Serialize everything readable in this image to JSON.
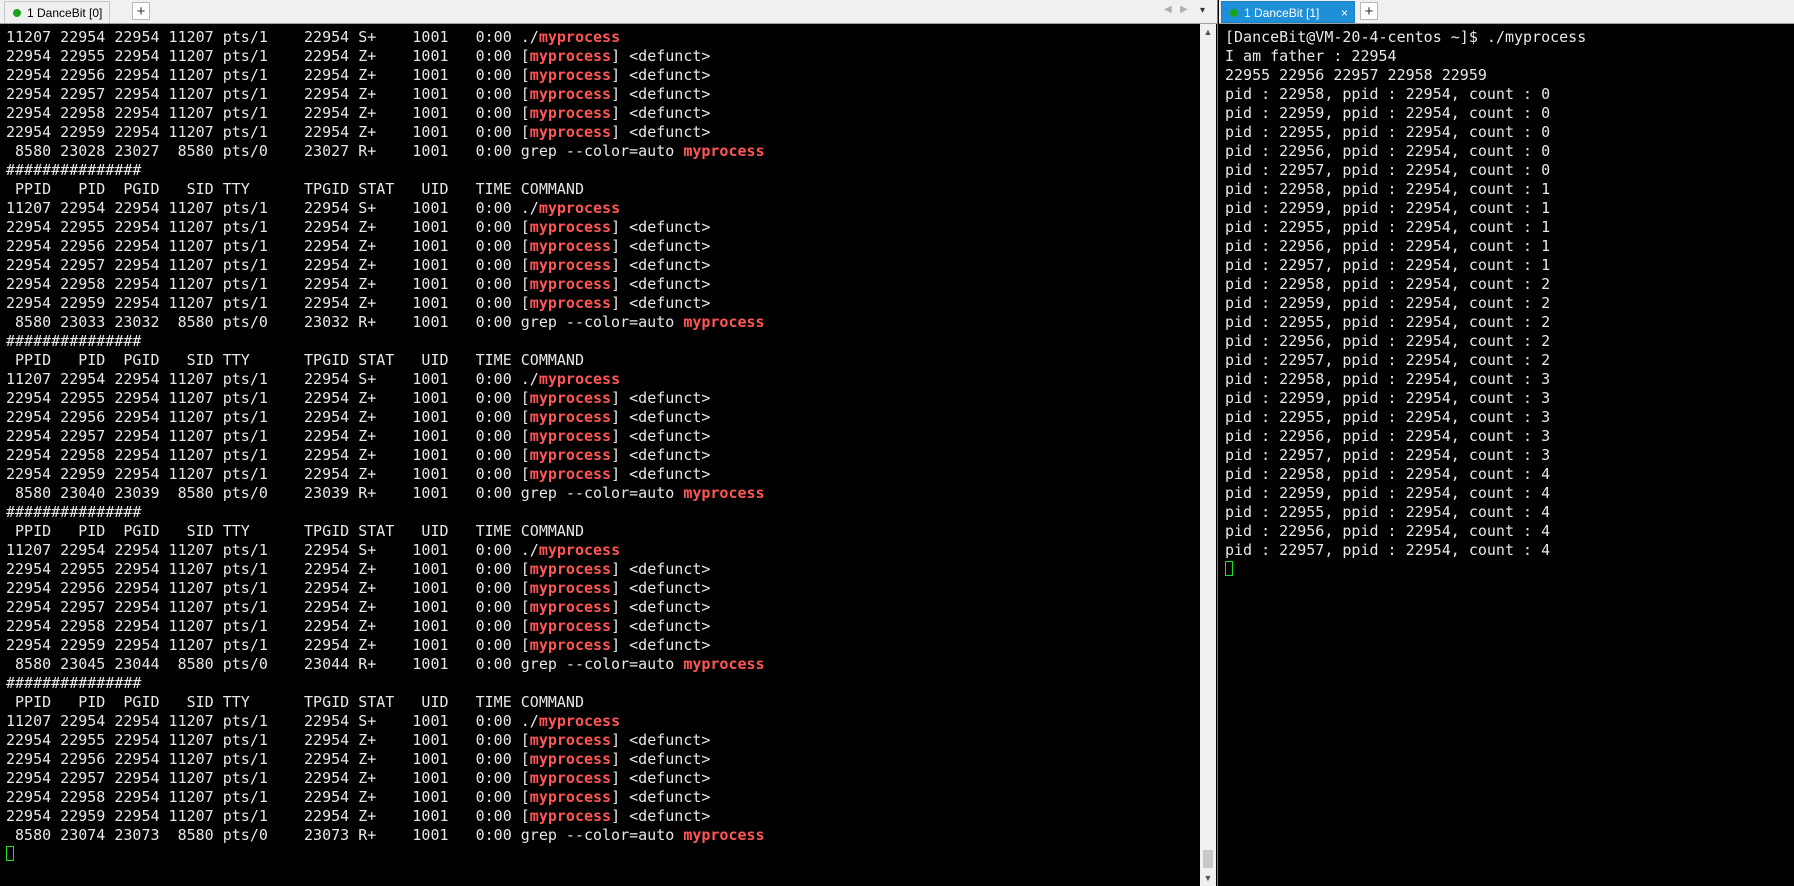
{
  "left": {
    "tab_label": "1 DanceBit [0]",
    "add_tab": "+",
    "nav_prev": "◀",
    "nav_next": "▶",
    "nav_menu": "▾",
    "lines": [
      {
        "pre": "11207 22954 22954 11207 pts/1    22954 S+    1001   0:00 ./",
        "hl": "myprocess",
        "post": ""
      },
      {
        "pre": "22954 22955 22954 11207 pts/1    22954 Z+    1001   0:00 [",
        "hl": "myprocess",
        "post": "] <defunct>"
      },
      {
        "pre": "22954 22956 22954 11207 pts/1    22954 Z+    1001   0:00 [",
        "hl": "myprocess",
        "post": "] <defunct>"
      },
      {
        "pre": "22954 22957 22954 11207 pts/1    22954 Z+    1001   0:00 [",
        "hl": "myprocess",
        "post": "] <defunct>"
      },
      {
        "pre": "22954 22958 22954 11207 pts/1    22954 Z+    1001   0:00 [",
        "hl": "myprocess",
        "post": "] <defunct>"
      },
      {
        "pre": "22954 22959 22954 11207 pts/1    22954 Z+    1001   0:00 [",
        "hl": "myprocess",
        "post": "] <defunct>"
      },
      {
        "pre": " 8580 23028 23027  8580 pts/0    23027 R+    1001   0:00 grep --color=auto ",
        "hl": "myprocess",
        "post": ""
      },
      {
        "pre": "###############",
        "hl": "",
        "post": ""
      },
      {
        "pre": " PPID   PID  PGID   SID TTY      TPGID STAT   UID   TIME COMMAND",
        "hl": "",
        "post": ""
      },
      {
        "pre": "11207 22954 22954 11207 pts/1    22954 S+    1001   0:00 ./",
        "hl": "myprocess",
        "post": ""
      },
      {
        "pre": "22954 22955 22954 11207 pts/1    22954 Z+    1001   0:00 [",
        "hl": "myprocess",
        "post": "] <defunct>"
      },
      {
        "pre": "22954 22956 22954 11207 pts/1    22954 Z+    1001   0:00 [",
        "hl": "myprocess",
        "post": "] <defunct>"
      },
      {
        "pre": "22954 22957 22954 11207 pts/1    22954 Z+    1001   0:00 [",
        "hl": "myprocess",
        "post": "] <defunct>"
      },
      {
        "pre": "22954 22958 22954 11207 pts/1    22954 Z+    1001   0:00 [",
        "hl": "myprocess",
        "post": "] <defunct>"
      },
      {
        "pre": "22954 22959 22954 11207 pts/1    22954 Z+    1001   0:00 [",
        "hl": "myprocess",
        "post": "] <defunct>"
      },
      {
        "pre": " 8580 23033 23032  8580 pts/0    23032 R+    1001   0:00 grep --color=auto ",
        "hl": "myprocess",
        "post": ""
      },
      {
        "pre": "###############",
        "hl": "",
        "post": ""
      },
      {
        "pre": " PPID   PID  PGID   SID TTY      TPGID STAT   UID   TIME COMMAND",
        "hl": "",
        "post": ""
      },
      {
        "pre": "11207 22954 22954 11207 pts/1    22954 S+    1001   0:00 ./",
        "hl": "myprocess",
        "post": ""
      },
      {
        "pre": "22954 22955 22954 11207 pts/1    22954 Z+    1001   0:00 [",
        "hl": "myprocess",
        "post": "] <defunct>"
      },
      {
        "pre": "22954 22956 22954 11207 pts/1    22954 Z+    1001   0:00 [",
        "hl": "myprocess",
        "post": "] <defunct>"
      },
      {
        "pre": "22954 22957 22954 11207 pts/1    22954 Z+    1001   0:00 [",
        "hl": "myprocess",
        "post": "] <defunct>"
      },
      {
        "pre": "22954 22958 22954 11207 pts/1    22954 Z+    1001   0:00 [",
        "hl": "myprocess",
        "post": "] <defunct>"
      },
      {
        "pre": "22954 22959 22954 11207 pts/1    22954 Z+    1001   0:00 [",
        "hl": "myprocess",
        "post": "] <defunct>"
      },
      {
        "pre": " 8580 23040 23039  8580 pts/0    23039 R+    1001   0:00 grep --color=auto ",
        "hl": "myprocess",
        "post": ""
      },
      {
        "pre": "###############",
        "hl": "",
        "post": ""
      },
      {
        "pre": " PPID   PID  PGID   SID TTY      TPGID STAT   UID   TIME COMMAND",
        "hl": "",
        "post": ""
      },
      {
        "pre": "11207 22954 22954 11207 pts/1    22954 S+    1001   0:00 ./",
        "hl": "myprocess",
        "post": ""
      },
      {
        "pre": "22954 22955 22954 11207 pts/1    22954 Z+    1001   0:00 [",
        "hl": "myprocess",
        "post": "] <defunct>"
      },
      {
        "pre": "22954 22956 22954 11207 pts/1    22954 Z+    1001   0:00 [",
        "hl": "myprocess",
        "post": "] <defunct>"
      },
      {
        "pre": "22954 22957 22954 11207 pts/1    22954 Z+    1001   0:00 [",
        "hl": "myprocess",
        "post": "] <defunct>"
      },
      {
        "pre": "22954 22958 22954 11207 pts/1    22954 Z+    1001   0:00 [",
        "hl": "myprocess",
        "post": "] <defunct>"
      },
      {
        "pre": "22954 22959 22954 11207 pts/1    22954 Z+    1001   0:00 [",
        "hl": "myprocess",
        "post": "] <defunct>"
      },
      {
        "pre": " 8580 23045 23044  8580 pts/0    23044 R+    1001   0:00 grep --color=auto ",
        "hl": "myprocess",
        "post": ""
      },
      {
        "pre": "###############",
        "hl": "",
        "post": ""
      },
      {
        "pre": " PPID   PID  PGID   SID TTY      TPGID STAT   UID   TIME COMMAND",
        "hl": "",
        "post": ""
      },
      {
        "pre": "11207 22954 22954 11207 pts/1    22954 S+    1001   0:00 ./",
        "hl": "myprocess",
        "post": ""
      },
      {
        "pre": "22954 22955 22954 11207 pts/1    22954 Z+    1001   0:00 [",
        "hl": "myprocess",
        "post": "] <defunct>"
      },
      {
        "pre": "22954 22956 22954 11207 pts/1    22954 Z+    1001   0:00 [",
        "hl": "myprocess",
        "post": "] <defunct>"
      },
      {
        "pre": "22954 22957 22954 11207 pts/1    22954 Z+    1001   0:00 [",
        "hl": "myprocess",
        "post": "] <defunct>"
      },
      {
        "pre": "22954 22958 22954 11207 pts/1    22954 Z+    1001   0:00 [",
        "hl": "myprocess",
        "post": "] <defunct>"
      },
      {
        "pre": "22954 22959 22954 11207 pts/1    22954 Z+    1001   0:00 [",
        "hl": "myprocess",
        "post": "] <defunct>"
      },
      {
        "pre": " 8580 23074 23073  8580 pts/0    23073 R+    1001   0:00 grep --color=auto ",
        "hl": "myprocess",
        "post": ""
      }
    ]
  },
  "right": {
    "tab_label": "1 DanceBit [1]",
    "close_glyph": "×",
    "add_tab": "+",
    "lines": [
      "[DanceBit@VM-20-4-centos ~]$ ./myprocess",
      "I am father : 22954",
      "22955 22956 22957 22958 22959",
      "pid : 22958, ppid : 22954, count : 0",
      "pid : 22959, ppid : 22954, count : 0",
      "pid : 22955, ppid : 22954, count : 0",
      "pid : 22956, ppid : 22954, count : 0",
      "pid : 22957, ppid : 22954, count : 0",
      "pid : 22958, ppid : 22954, count : 1",
      "pid : 22959, ppid : 22954, count : 1",
      "pid : 22955, ppid : 22954, count : 1",
      "pid : 22956, ppid : 22954, count : 1",
      "pid : 22957, ppid : 22954, count : 1",
      "pid : 22958, ppid : 22954, count : 2",
      "pid : 22959, ppid : 22954, count : 2",
      "pid : 22955, ppid : 22954, count : 2",
      "pid : 22956, ppid : 22954, count : 2",
      "pid : 22957, ppid : 22954, count : 2",
      "pid : 22958, ppid : 22954, count : 3",
      "pid : 22959, ppid : 22954, count : 3",
      "pid : 22955, ppid : 22954, count : 3",
      "pid : 22956, ppid : 22954, count : 3",
      "pid : 22957, ppid : 22954, count : 3",
      "pid : 22958, ppid : 22954, count : 4",
      "pid : 22959, ppid : 22954, count : 4",
      "pid : 22955, ppid : 22954, count : 4",
      "pid : 22956, ppid : 22954, count : 4",
      "pid : 22957, ppid : 22954, count : 4"
    ]
  },
  "scrollbar": {
    "up_glyph": "▲",
    "down_glyph": "▼"
  },
  "colors": {
    "highlight": "#ff5555",
    "cursor": "#1ee01e",
    "active_tab": "#1e90d8"
  }
}
